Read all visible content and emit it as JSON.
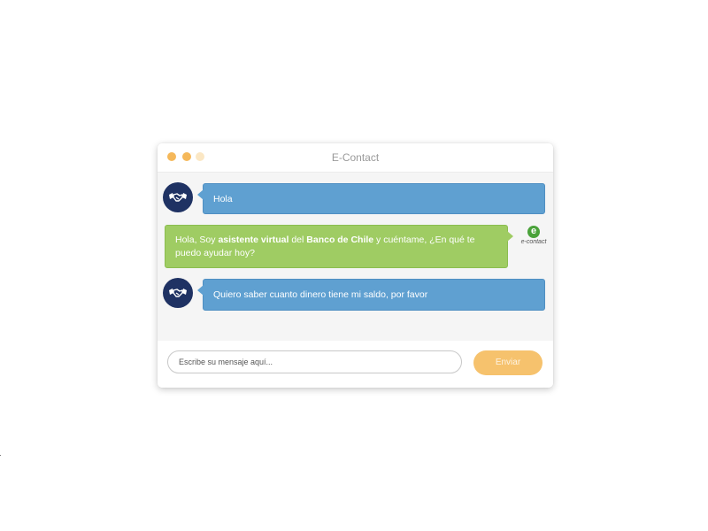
{
  "window": {
    "title": "E-Contact"
  },
  "messages": [
    {
      "sender": "user",
      "text": "Hola"
    },
    {
      "sender": "bot",
      "segments": [
        {
          "text": "Hola, Soy ",
          "bold": false
        },
        {
          "text": "asistente virtual",
          "bold": true
        },
        {
          "text": " del ",
          "bold": false
        },
        {
          "text": "Banco de Chile",
          "bold": true
        },
        {
          "text": " y cuéntame, ¿En qué te puedo ayudar hoy?",
          "bold": false
        }
      ]
    },
    {
      "sender": "user",
      "text": "Quiero saber cuanto dinero tiene mi saldo, por favor"
    }
  ],
  "bot_logo": {
    "letter": "e",
    "text": "e-contact"
  },
  "composer": {
    "placeholder": "Escribe su mensaje aquí...",
    "send_label": "Enviar"
  },
  "icons": {
    "user_avatar": "handshake-icon",
    "bot_avatar": "e-contact-logo"
  },
  "colors": {
    "user_bubble": "#5fa0d1",
    "bot_bubble": "#9fcc63",
    "avatar_bg": "#1f3263",
    "send_button": "#f6c26d",
    "window_dots": "#f5b85a"
  }
}
